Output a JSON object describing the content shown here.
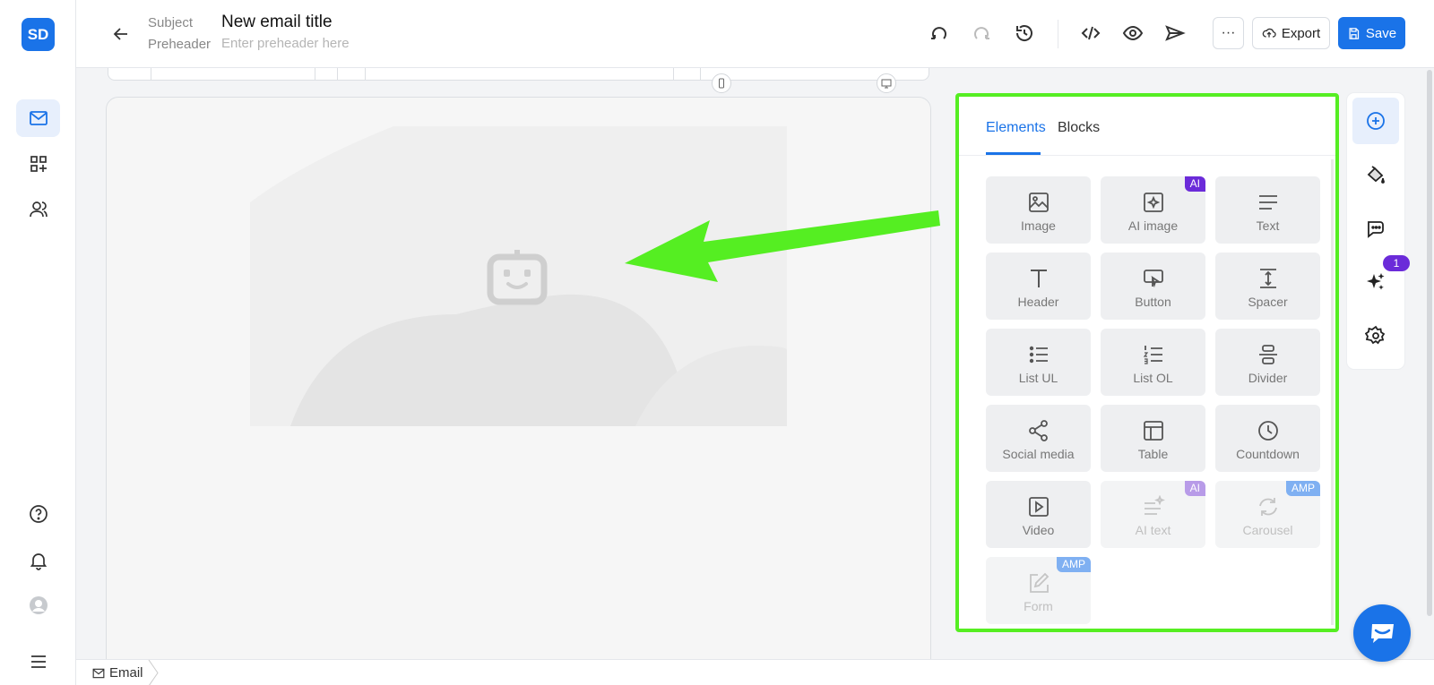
{
  "app": {
    "logo_text": "SD"
  },
  "leftnav": {
    "items": [
      {
        "icon": "mail-icon",
        "active": true
      },
      {
        "icon": "grid-plus-icon",
        "active": false
      },
      {
        "icon": "users-icon",
        "active": false
      }
    ],
    "bottom_items": [
      "help-icon",
      "bell-icon",
      "avatar-icon",
      "menu-icon"
    ]
  },
  "header": {
    "subject_label": "Subject",
    "preheader_label": "Preheader",
    "title": "New email title",
    "preheader_placeholder": "Enter preheader here",
    "more_label": "···",
    "export_label": "Export",
    "save_label": "Save"
  },
  "panel": {
    "tabs": [
      {
        "label": "Elements",
        "active": true
      },
      {
        "label": "Blocks",
        "active": false
      }
    ],
    "tiles": [
      {
        "label": "Image",
        "icon": "image-icon"
      },
      {
        "label": "AI image",
        "icon": "ai-image-icon",
        "badge": "AI"
      },
      {
        "label": "Text",
        "icon": "text-icon"
      },
      {
        "label": "Header",
        "icon": "header-icon"
      },
      {
        "label": "Button",
        "icon": "button-icon"
      },
      {
        "label": "Spacer",
        "icon": "spacer-icon"
      },
      {
        "label": "List UL",
        "icon": "list-ul-icon"
      },
      {
        "label": "List OL",
        "icon": "list-ol-icon"
      },
      {
        "label": "Divider",
        "icon": "divider-icon"
      },
      {
        "label": "Social media",
        "icon": "share-icon"
      },
      {
        "label": "Table",
        "icon": "table-icon"
      },
      {
        "label": "Countdown",
        "icon": "clock-icon"
      },
      {
        "label": "Video",
        "icon": "video-icon"
      },
      {
        "label": "AI text",
        "icon": "ai-text-icon",
        "badge": "AI",
        "disabled": true
      },
      {
        "label": "Carousel",
        "icon": "carousel-icon",
        "badge": "AMP",
        "disabled": true
      },
      {
        "label": "Form",
        "icon": "form-icon",
        "badge": "AMP",
        "disabled": true
      }
    ]
  },
  "rightrail": {
    "notification_count": "1"
  },
  "footer": {
    "tab_label": "Email"
  },
  "colors": {
    "accent": "#1a73e8",
    "highlight": "#55ee22",
    "ai_badge": "#6b2bd9",
    "amp_badge": "#7fb0f2"
  }
}
